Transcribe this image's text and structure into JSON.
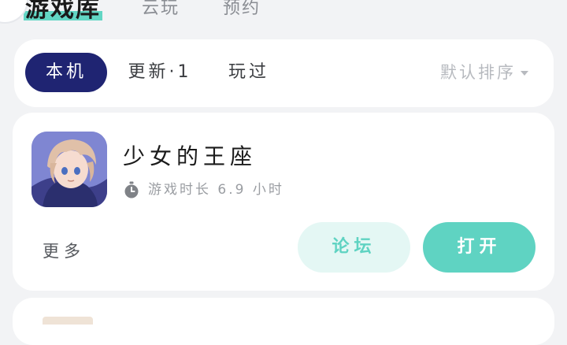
{
  "top_tabs": [
    {
      "label": "游戏库",
      "active": true
    },
    {
      "label": "云玩",
      "active": false
    },
    {
      "label": "预约",
      "active": false
    }
  ],
  "filters": {
    "chips": [
      {
        "label": "本机",
        "active": true
      },
      {
        "label": "更新·1",
        "active": false
      },
      {
        "label": "玩过",
        "active": false
      }
    ],
    "sort_label": "默认排序"
  },
  "game": {
    "title": "少女的王座",
    "playtime_text": "游戏时长 6.9 小时",
    "more_label": "更多",
    "forum_button": "论坛",
    "open_button": "打开",
    "icon": "game-cover-anime-boy"
  },
  "colors": {
    "accent_teal": "#5fd3c2",
    "active_chip_navy": "#1f2472",
    "background": "#f2f3f5"
  }
}
